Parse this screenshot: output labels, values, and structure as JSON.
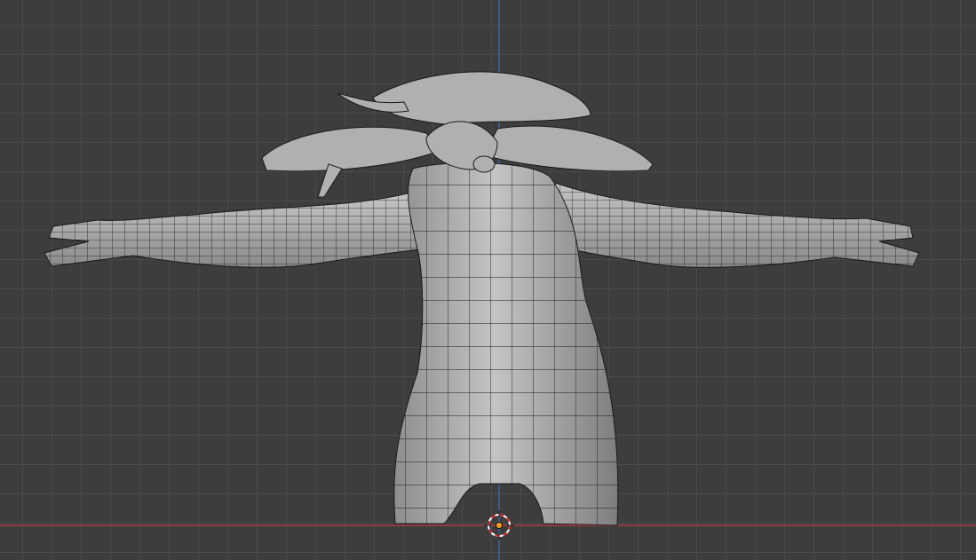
{
  "viewport": {
    "background_color": "#3d3d3d",
    "grid_color": "#4a4a4a",
    "x_axis_color": "#c23b4a",
    "z_axis_color": "#3b6db0",
    "mesh_color": "#b4b4b4",
    "wire_color": "#1a1a1a"
  },
  "icons": {
    "cursor": "3d-cursor-icon",
    "origin": "object-origin-icon"
  }
}
